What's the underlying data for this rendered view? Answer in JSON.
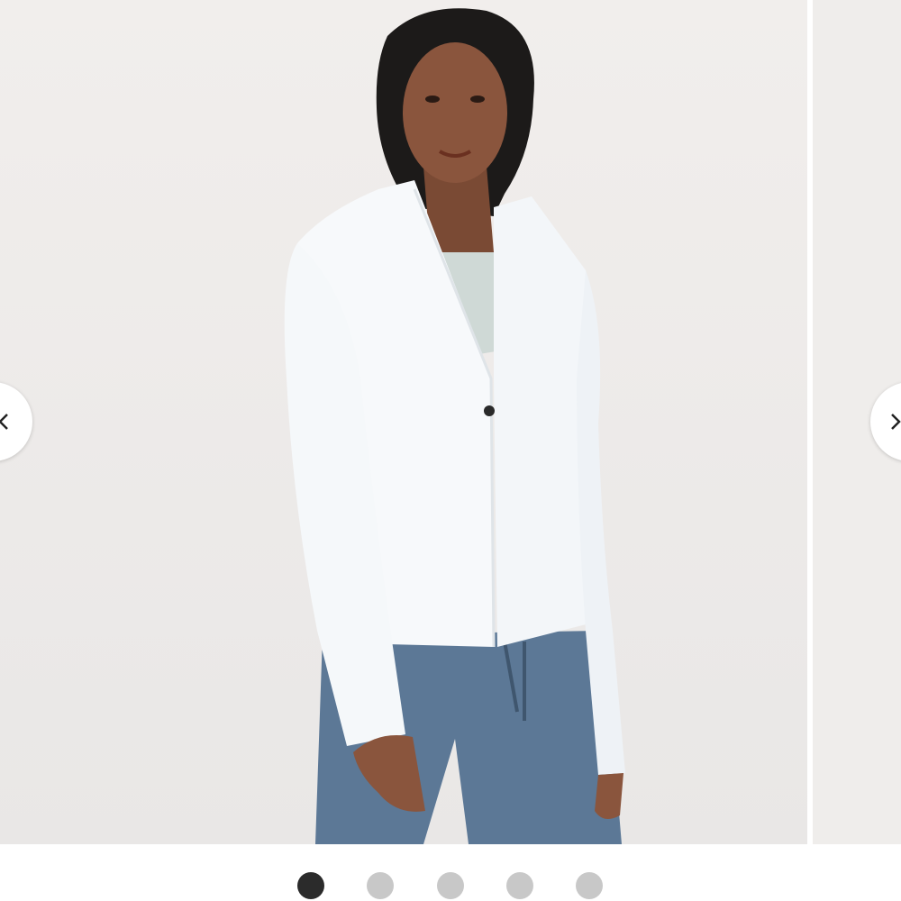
{
  "carousel": {
    "slides": [
      {
        "image": "product-photo-white-zip-jacket"
      },
      {
        "image": "product-photo-next-partial"
      }
    ],
    "prev_icon": "chevron-left-icon",
    "next_icon": "chevron-right-icon",
    "active_index": 0,
    "dot_count": 5
  },
  "colors": {
    "background": "#efedeb",
    "jacket": "#f7f9fb",
    "pants": "#5c7896",
    "dot_active": "#2b2b2b",
    "dot_inactive": "#c8c8c8"
  }
}
